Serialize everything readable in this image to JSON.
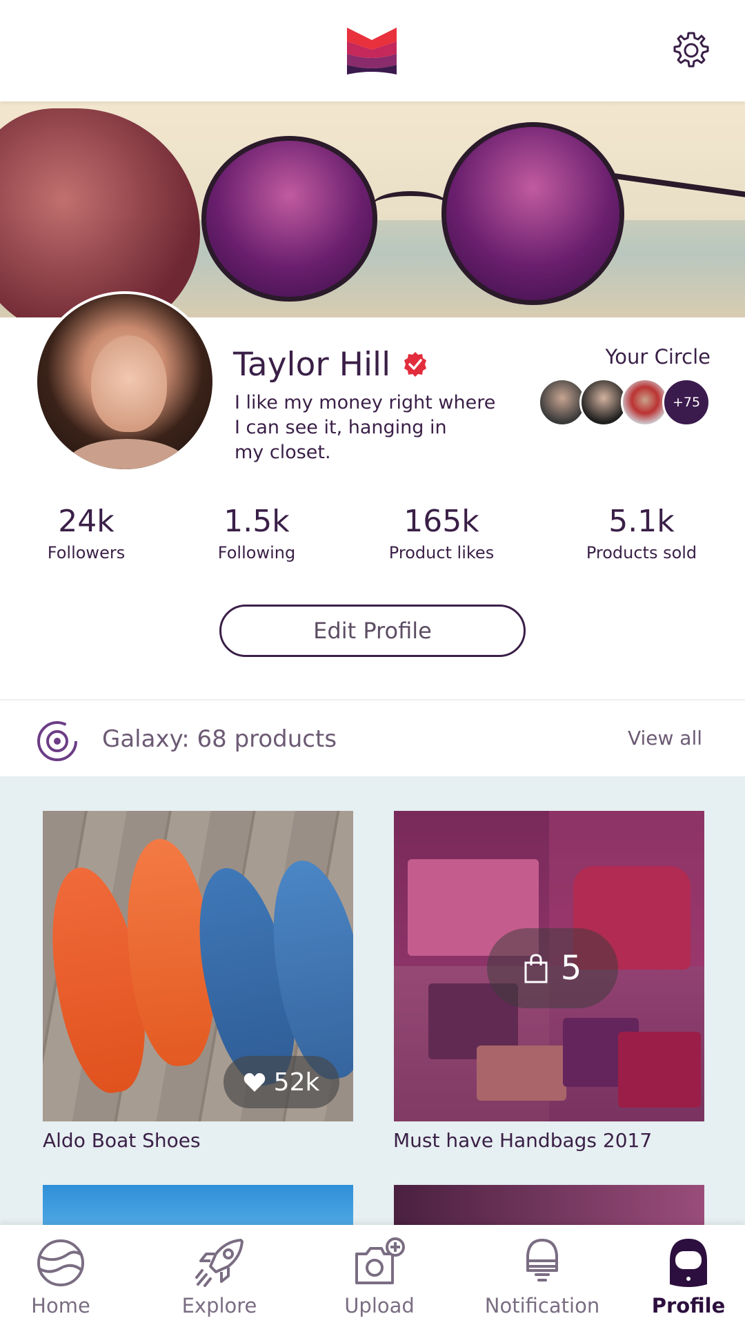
{
  "header": {
    "logo_icon": "brand-logo-icon",
    "settings_icon": "gear-icon"
  },
  "profile": {
    "name": "Taylor Hill",
    "verified_icon": "verified-badge-icon",
    "bio_lines": [
      "I like my money right where",
      "I can see it, hanging in",
      "my closet."
    ]
  },
  "circle": {
    "title": "Your Circle",
    "more_count": "+75"
  },
  "stats": [
    {
      "value": "24k",
      "label": "Followers"
    },
    {
      "value": "1.5k",
      "label": "Following"
    },
    {
      "value": "165k",
      "label": "Product likes"
    },
    {
      "value": "5.1k",
      "label": "Products sold"
    }
  ],
  "edit_profile_label": "Edit Profile",
  "galaxy": {
    "title": "Galaxy: 68 products",
    "view_all": "View all"
  },
  "products": [
    {
      "title": "Aldo Boat Shoes",
      "likes": "52k"
    },
    {
      "title": "Must have Handbags 2017",
      "count": "5"
    }
  ],
  "nav": [
    {
      "label": "Home",
      "icon": "planet-icon"
    },
    {
      "label": "Explore",
      "icon": "rocket-icon"
    },
    {
      "label": "Upload",
      "icon": "camera-plus-icon"
    },
    {
      "label": "Notification",
      "icon": "bell-icon"
    },
    {
      "label": "Profile",
      "icon": "astronaut-icon",
      "active": true
    }
  ],
  "colors": {
    "primary": "#3a1f47",
    "accent_red": "#e22d3d",
    "grid_bg": "#e6eff1"
  }
}
